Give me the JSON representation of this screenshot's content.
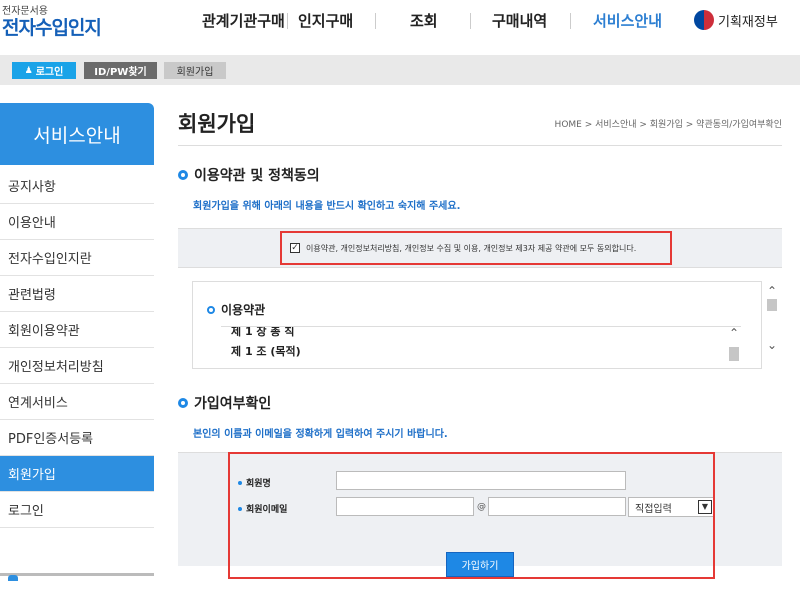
{
  "header": {
    "logo_small": "전자문서용",
    "logo_big": "전자수입인지",
    "nav": [
      "관계기관구매",
      "인지구매",
      "조회",
      "구매내역",
      "서비스안내"
    ],
    "gov_label": "기획재정부"
  },
  "utilbar": {
    "login": "로그인",
    "idpw": "ID/PW찾기",
    "join": "회원가입"
  },
  "sidebar": {
    "title": "서비스안내",
    "items": [
      "공지사항",
      "이용안내",
      "전자수입인지란",
      "관련법령",
      "회원이용약관",
      "개인정보처리방침",
      "연계서비스",
      "PDF인증서등록",
      "회원가입",
      "로그인"
    ],
    "active_index": 8
  },
  "main": {
    "title": "회원가입",
    "breadcrumb": "HOME > 서비스안내 > 회원가입 > 약관동의/가입여부확인",
    "section1": {
      "title": "이용약관 및 정책동의",
      "desc": "회원가입을 위해 아래의 내용을 반드시 확인하고 숙지해 주세요.",
      "agree_label": "이용약관, 개인정보처리방침, 개인정보 수집 및 이용, 개인정보 제3자 제공 약관에 모두 동의합니다.",
      "agree_checked": true
    },
    "terms": {
      "title": "이용약관",
      "line1": "제 1 장 총 칙",
      "line2": "제 1 조 (목적)"
    },
    "section2": {
      "title": "가입여부확인",
      "desc": "본인의 이름과 이메일을 정확하게 입력하여 주시기 바랍니다."
    },
    "form": {
      "name_label": "회원명",
      "name_value": "",
      "email_label": "회원이메일",
      "email_id_value": "",
      "at": "@",
      "email_domain_value": "",
      "domain_select": "직접입력",
      "submit": "가입하기"
    }
  },
  "colors": {
    "accent": "#2d8fe0",
    "highlight_frame": "#e53935"
  }
}
